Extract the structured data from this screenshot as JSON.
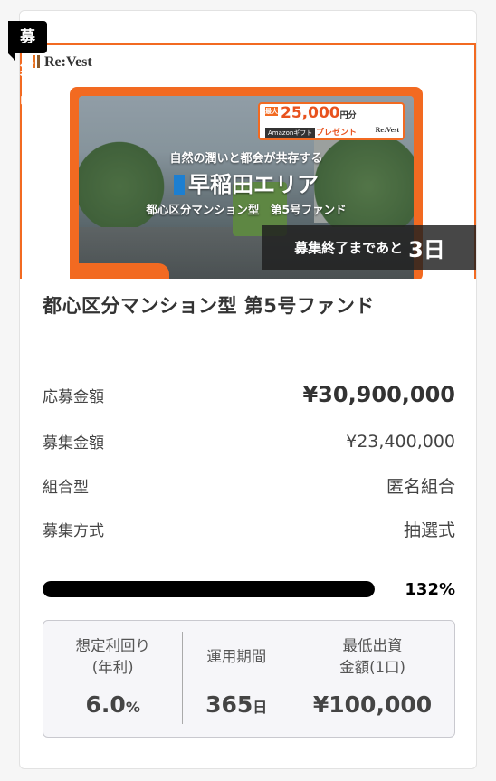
{
  "badge": "募集中",
  "banner": {
    "logo": "Re:Vest",
    "catch_line1": "自然の潤いと都会が共存する",
    "catch_line2": "早稲田エリア",
    "catch_line3": "都心区分マンション型　第5号ファンド",
    "promo": {
      "max": "最大",
      "amount": "25,000",
      "unit": "円分",
      "amazon": "Amazonギフト",
      "present": "プレゼント",
      "logo": "Re:Vest"
    }
  },
  "countdown": {
    "prefix": "募集終了まであと",
    "days": "3日"
  },
  "fund_title": "都心区分マンション型 第5号ファンド",
  "details": [
    {
      "label": "応募金額",
      "value": "¥30,900,000"
    },
    {
      "label": "募集金額",
      "value": "¥23,400,000"
    },
    {
      "label": "組合型",
      "value": "匿名組合"
    },
    {
      "label": "募集方式",
      "value": "抽選式"
    }
  ],
  "progress": {
    "percent_label": "132%",
    "fill_fraction": 1.0
  },
  "stats": [
    {
      "label_line1": "想定利回り",
      "label_line2": "(年利)",
      "value": "6.0",
      "unit": "%"
    },
    {
      "label_line1": "運用期間",
      "label_line2": "",
      "value": "365",
      "unit": "日"
    },
    {
      "label_line1": "最低出資",
      "label_line2": "金額(1口)",
      "value": "¥100,000",
      "unit": ""
    }
  ],
  "colors": {
    "accent": "#f26a21",
    "badge_bg": "#000000",
    "progress_fill": "#000000"
  }
}
